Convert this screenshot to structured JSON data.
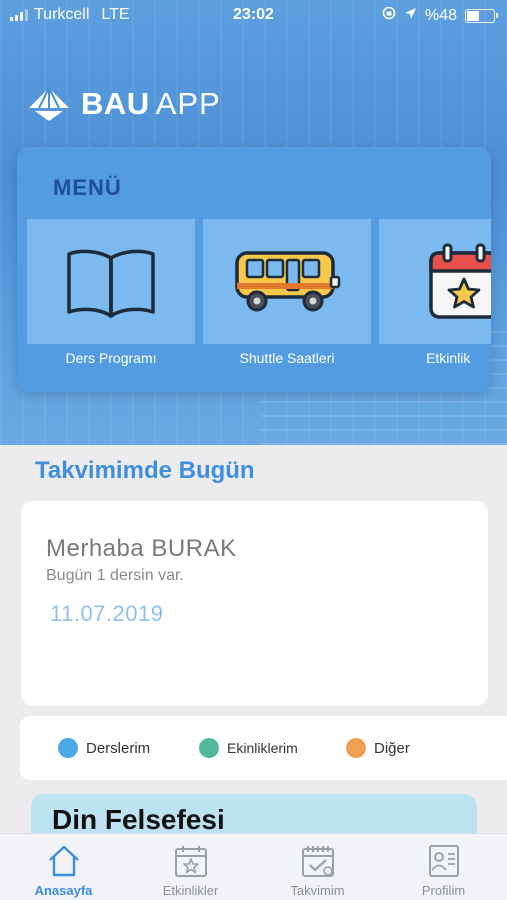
{
  "status": {
    "carrier": "Turkcell",
    "network": "LTE",
    "time": "23:02",
    "battery_text": "%48",
    "battery_level": 0.48
  },
  "brand": {
    "name": "BAU",
    "suffix": "APP"
  },
  "menu": {
    "title": "MENÜ",
    "items": [
      {
        "label": "Ders Programı",
        "icon": "book-icon"
      },
      {
        "label": "Shuttle Saatleri",
        "icon": "bus-icon"
      },
      {
        "label": "Etkinlik",
        "icon": "calendar-star-icon"
      }
    ]
  },
  "today": {
    "section_title": "Takvimimde Bugün",
    "greeting": "Merhaba BURAK",
    "summary": "Bugün  1 dersin var.",
    "date": "11.07.2019"
  },
  "legend": [
    {
      "label": "Derslerim",
      "color": "#4aa9e6"
    },
    {
      "label": "Ekinliklerim",
      "color": "#52b89a"
    },
    {
      "label": "Diğer",
      "color": "#f0a050"
    }
  ],
  "course": {
    "title": "Din Felsefesi"
  },
  "tabs": [
    {
      "label": "Anasayfa",
      "icon": "home-icon",
      "active": true
    },
    {
      "label": "Etkinlikler",
      "icon": "calendar-star-icon",
      "active": false
    },
    {
      "label": "Takvimim",
      "icon": "calendar-check-icon",
      "active": false
    },
    {
      "label": "Profilim",
      "icon": "profile-card-icon",
      "active": false
    }
  ],
  "colors": {
    "accent": "#3c8ee0",
    "menu_card": "#549ce2",
    "menu_title": "#1f4f99",
    "tile": "#7bb9ee"
  }
}
